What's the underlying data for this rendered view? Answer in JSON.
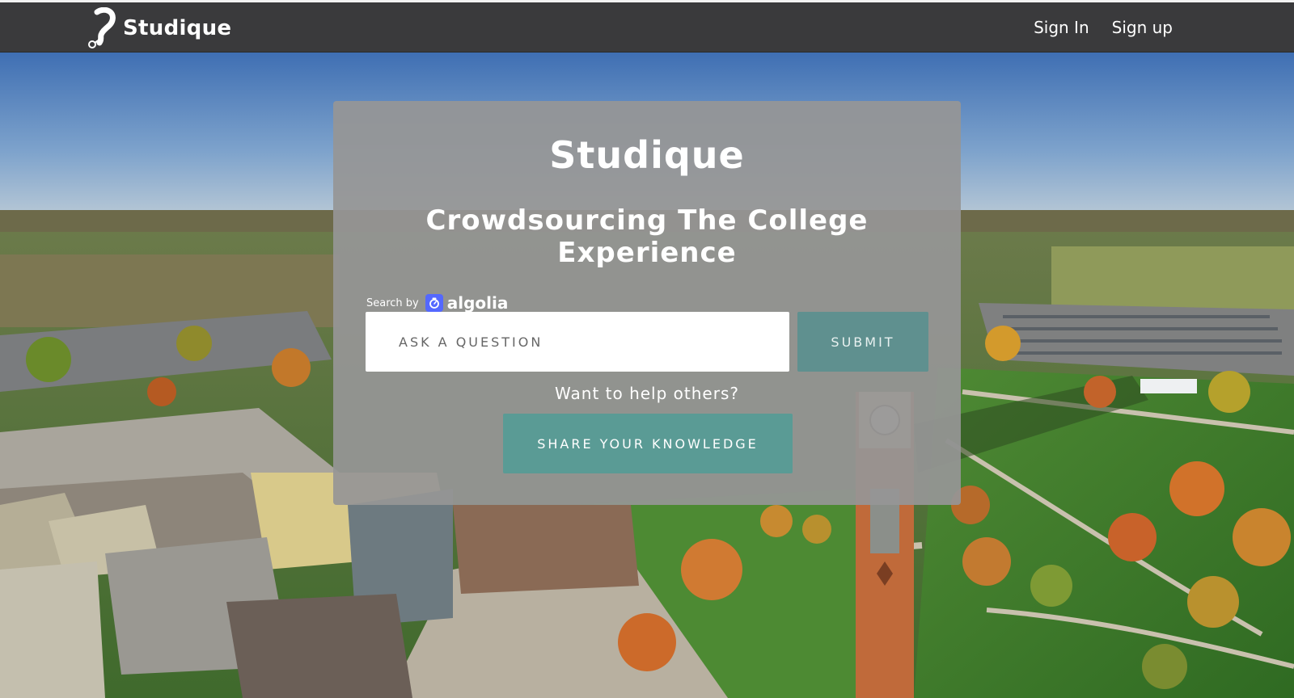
{
  "header": {
    "brand": "Studique",
    "nav": {
      "sign_in": "Sign In",
      "sign_up": "Sign up"
    }
  },
  "hero": {
    "title": "Studique",
    "subtitle": "Crowdsourcing The College Experience",
    "search_by_label": "Search by",
    "search_provider": "algolia",
    "search": {
      "placeholder": "ASK A QUESTION",
      "value": ""
    },
    "submit_label": "SUBMIT",
    "help_text": "Want to help others?",
    "share_label": "SHARE YOUR KNOWLEDGE"
  },
  "colors": {
    "navbar": "#3a3a3c",
    "card": "#969696",
    "submit": "#5f908f",
    "share": "#5a9b95",
    "algolia": "#5468ff"
  },
  "icons": [
    "studique-logo-icon",
    "algolia-logo-icon"
  ]
}
